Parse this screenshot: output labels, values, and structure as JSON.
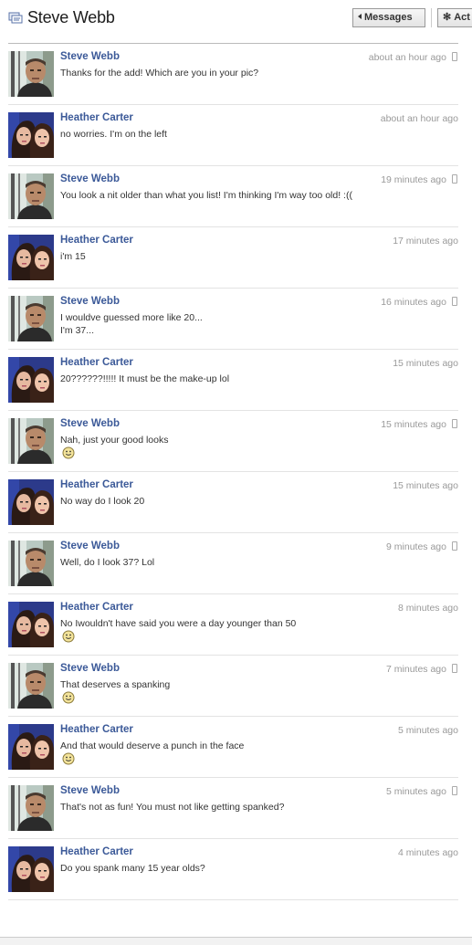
{
  "header": {
    "title": "Steve Webb",
    "title_icon": "messages-icon",
    "messages_button": "Messages",
    "actions_button": "Act"
  },
  "messages": [
    {
      "sender": "Steve Webb",
      "text": "Thanks for the add! Which are you in your pic?",
      "time": "about an hour ago",
      "mobile": true,
      "avatar": "steve",
      "smiley": false
    },
    {
      "sender": "Heather Carter",
      "text": "no worries. I'm on the left",
      "time": "about an hour ago",
      "mobile": false,
      "avatar": "heather",
      "smiley": false
    },
    {
      "sender": "Steve Webb",
      "text": "You look a nit older than what you list! I'm thinking I'm way too old! :((",
      "time": "19 minutes ago",
      "mobile": true,
      "avatar": "steve",
      "smiley": false
    },
    {
      "sender": "Heather Carter",
      "text": "i'm 15",
      "time": "17 minutes ago",
      "mobile": false,
      "avatar": "heather",
      "smiley": false
    },
    {
      "sender": "Steve Webb",
      "text": "I wouldve guessed more like 20...\nI'm 37...",
      "time": "16 minutes ago",
      "mobile": true,
      "avatar": "steve",
      "smiley": false
    },
    {
      "sender": "Heather Carter",
      "text": "20??????!!!!! It must be the make-up lol",
      "time": "15 minutes ago",
      "mobile": false,
      "avatar": "heather",
      "smiley": false
    },
    {
      "sender": "Steve Webb",
      "text": "Nah, just your good looks",
      "time": "15 minutes ago",
      "mobile": true,
      "avatar": "steve",
      "smiley": true
    },
    {
      "sender": "Heather Carter",
      "text": "No way do I look 20",
      "time": "15 minutes ago",
      "mobile": false,
      "avatar": "heather",
      "smiley": false
    },
    {
      "sender": "Steve Webb",
      "text": "Well, do I look 37? Lol",
      "time": "9 minutes ago",
      "mobile": true,
      "avatar": "steve",
      "smiley": false
    },
    {
      "sender": "Heather Carter",
      "text": "No Iwouldn't have said you were a day younger than 50",
      "time": "8 minutes ago",
      "mobile": false,
      "avatar": "heather",
      "smiley": true
    },
    {
      "sender": "Steve Webb",
      "text": "That deserves a spanking",
      "time": "7 minutes ago",
      "mobile": true,
      "avatar": "steve",
      "smiley": true
    },
    {
      "sender": "Heather Carter",
      "text": "And that would deserve a punch in the face",
      "time": "5 minutes ago",
      "mobile": false,
      "avatar": "heather",
      "smiley": true
    },
    {
      "sender": "Steve Webb",
      "text": "That's not as fun! You must not like getting spanked?",
      "time": "5 minutes ago",
      "mobile": true,
      "avatar": "steve",
      "smiley": false
    },
    {
      "sender": "Heather Carter",
      "text": "Do you spank many 15 year olds?",
      "time": "4 minutes ago",
      "mobile": false,
      "avatar": "heather",
      "smiley": false
    }
  ],
  "colors": {
    "link": "#3b5998",
    "timestamp": "#999999",
    "text": "#333333"
  }
}
